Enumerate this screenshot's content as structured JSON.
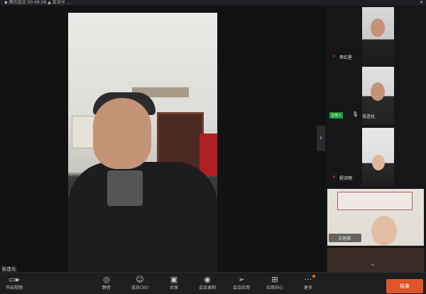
{
  "topbar": {
    "text": "◆ 腾讯会议  00:49:26  ▲ 会议号 ..."
  },
  "main_video": {
    "speaker_name": "张连化"
  },
  "participants": [
    {
      "name": "李红星",
      "muted": true
    },
    {
      "name": "张连化",
      "host_badge": "主持人",
      "muted": false
    },
    {
      "name": "程诗雨",
      "muted": true
    },
    {
      "name": "王思琪",
      "muted": true
    }
  ],
  "toolbar": {
    "video_label": "开启视频",
    "mute_label": "静音",
    "members_label": "成员(30)",
    "share_label": "共享",
    "record_label": "会议录制",
    "apps_label": "会议应用",
    "apps2_label": "应用中心",
    "more_label": "更多",
    "end_label": "结束"
  },
  "colors": {
    "accent_end": "#e0542b",
    "host_badge": "#1a9a3a",
    "muted_mic": "#e44444"
  }
}
